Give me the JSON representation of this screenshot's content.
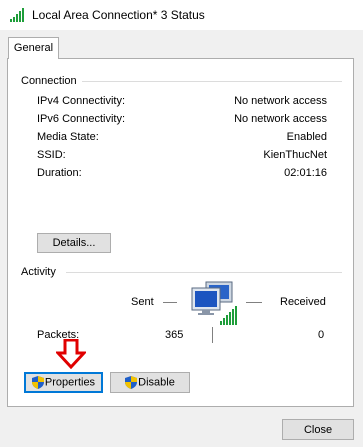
{
  "window": {
    "title": "Local Area Connection* 3 Status"
  },
  "tabs": [
    {
      "label": "General",
      "selected": true
    }
  ],
  "connection": {
    "group_label": "Connection",
    "rows": [
      {
        "label": "IPv4 Connectivity:",
        "value": "No network access"
      },
      {
        "label": "IPv6 Connectivity:",
        "value": "No network access"
      },
      {
        "label": "Media State:",
        "value": "Enabled"
      },
      {
        "label": "SSID:",
        "value": "KienThucNet"
      },
      {
        "label": "Duration:",
        "value": "02:01:16"
      }
    ],
    "details_button": "Details..."
  },
  "activity": {
    "group_label": "Activity",
    "sent_label": "Sent",
    "received_label": "Received",
    "packets_label": "Packets:",
    "packets_sent": "365",
    "packets_received": "0"
  },
  "buttons": {
    "properties": "Properties",
    "disable": "Disable",
    "close": "Close"
  },
  "colors": {
    "annotation_arrow": "#e00000",
    "focus_border": "#0078d7",
    "signal_green": "#1e9e3a"
  },
  "icons": [
    "wifi-signal-icon",
    "network-computers-icon",
    "uac-shield-icon",
    "red-arrow-down-icon"
  ]
}
